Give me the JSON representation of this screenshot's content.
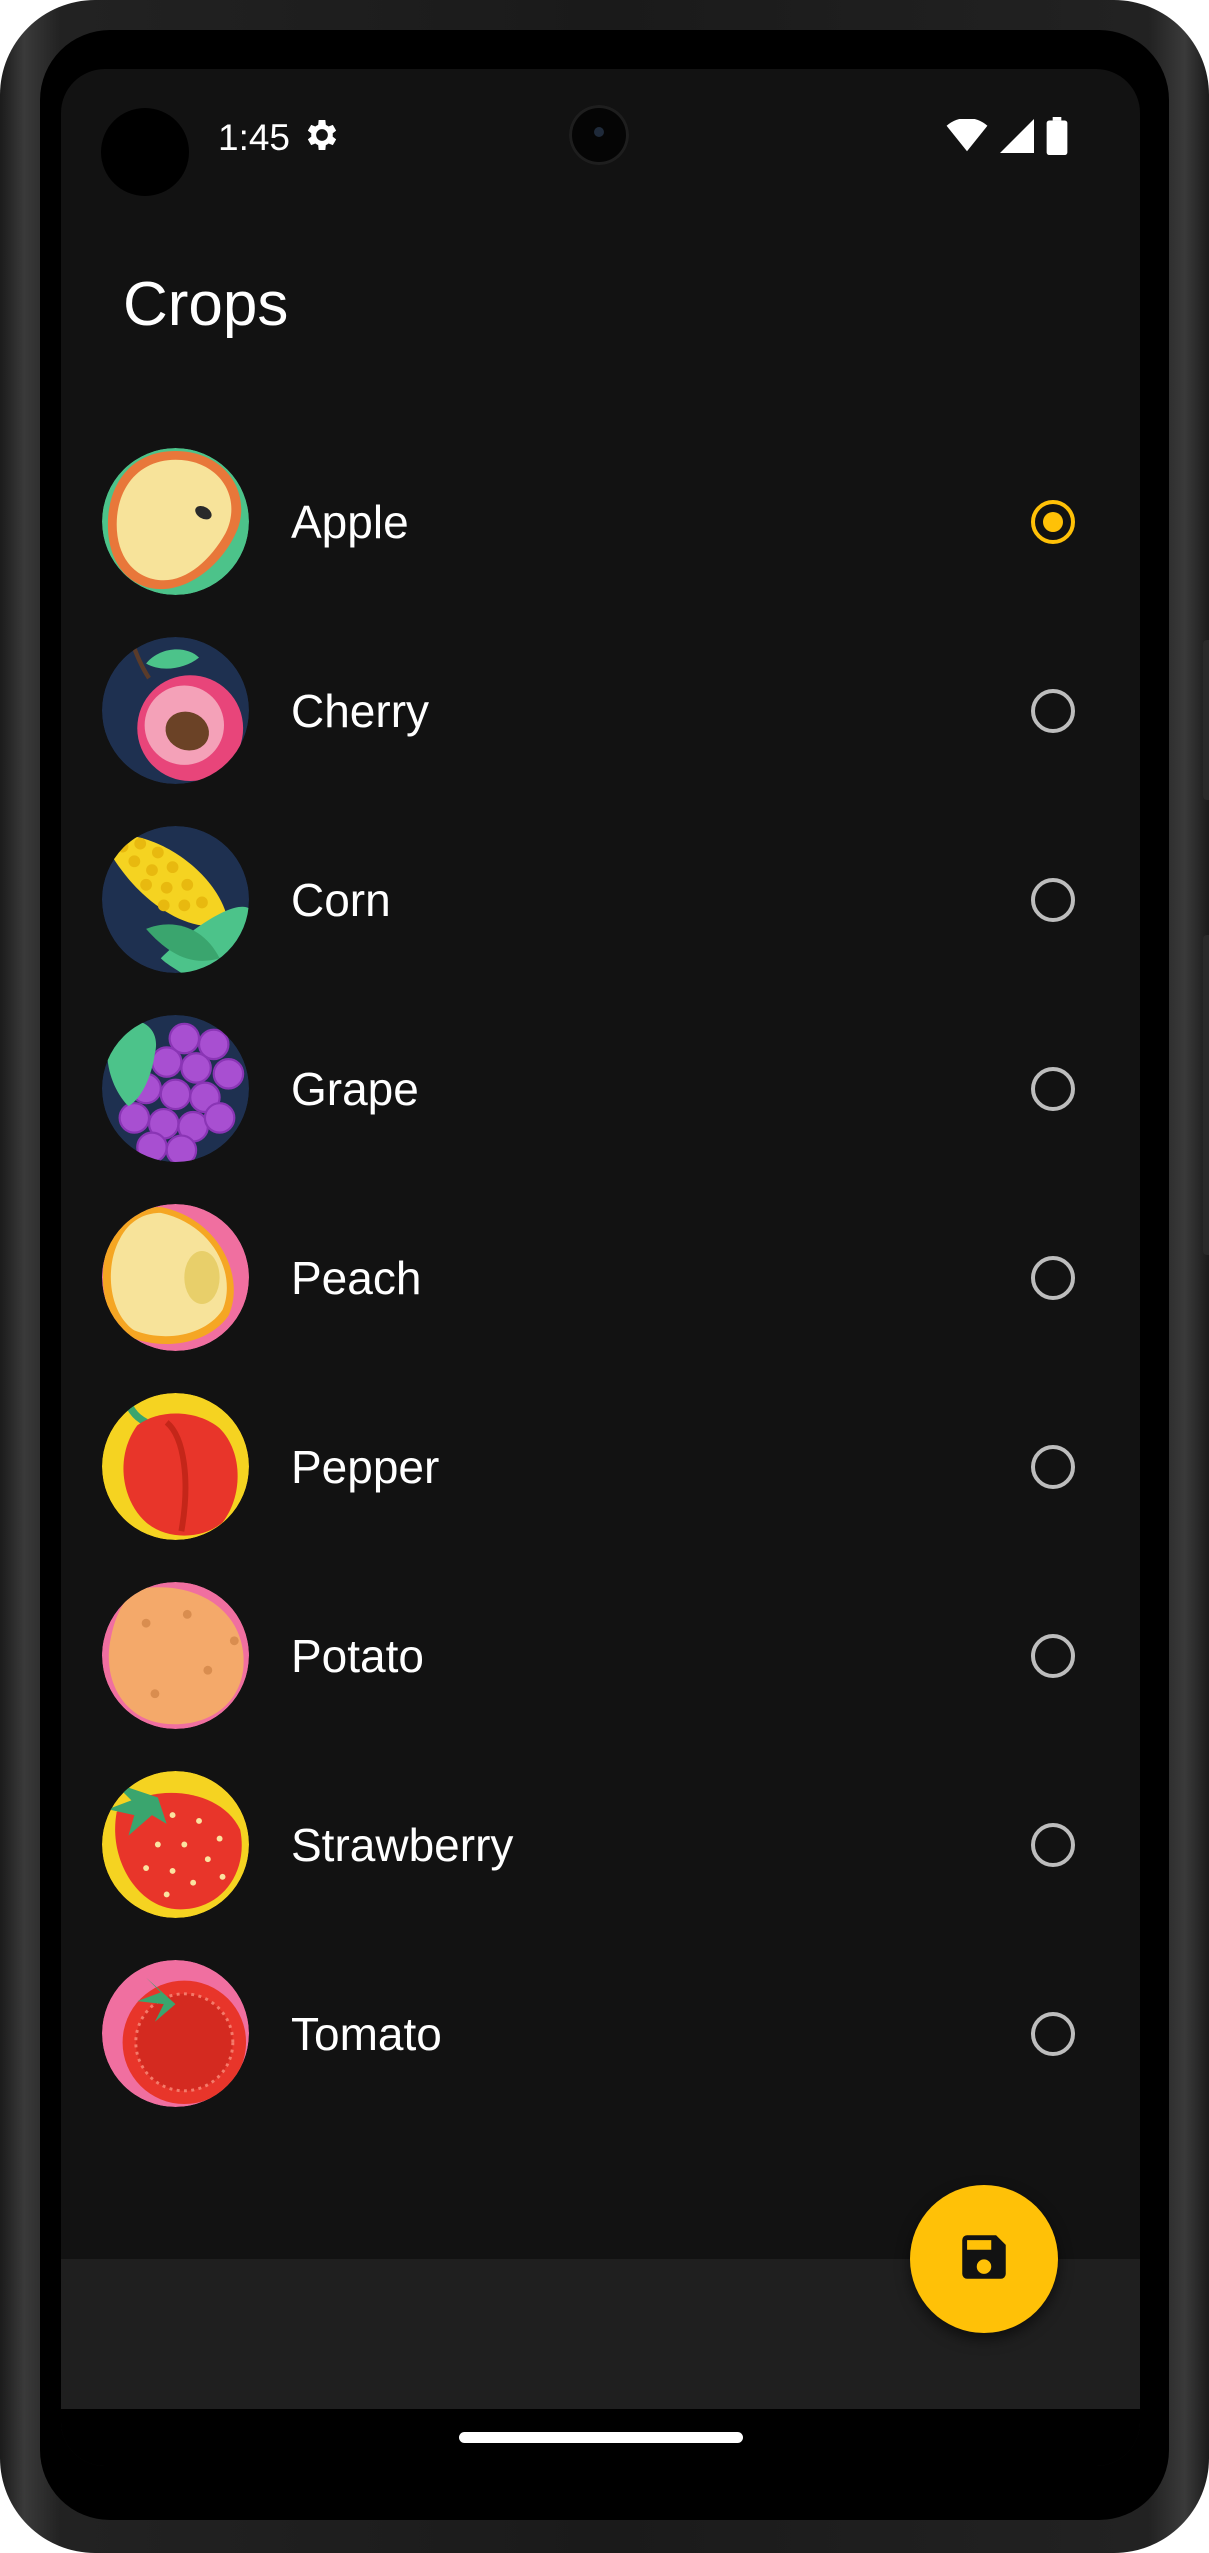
{
  "status_bar": {
    "time": "1:45",
    "icons": [
      "settings-gear-icon",
      "wifi-icon",
      "cell-signal-icon",
      "battery-icon"
    ]
  },
  "app": {
    "title": "Crops"
  },
  "crops": [
    {
      "label": "Apple",
      "icon": "apple-icon",
      "selected": true
    },
    {
      "label": "Cherry",
      "icon": "cherry-icon",
      "selected": false
    },
    {
      "label": "Corn",
      "icon": "corn-icon",
      "selected": false
    },
    {
      "label": "Grape",
      "icon": "grape-icon",
      "selected": false
    },
    {
      "label": "Peach",
      "icon": "peach-icon",
      "selected": false
    },
    {
      "label": "Pepper",
      "icon": "pepper-icon",
      "selected": false
    },
    {
      "label": "Potato",
      "icon": "potato-icon",
      "selected": false
    },
    {
      "label": "Strawberry",
      "icon": "strawberry-icon",
      "selected": false
    },
    {
      "label": "Tomato",
      "icon": "tomato-icon",
      "selected": false
    }
  ],
  "fab": {
    "icon": "save-icon"
  },
  "colors": {
    "accent": "#ffc107",
    "background": "#121212",
    "text": "#ffffff",
    "radio_unselected": "#bdbdbd"
  }
}
